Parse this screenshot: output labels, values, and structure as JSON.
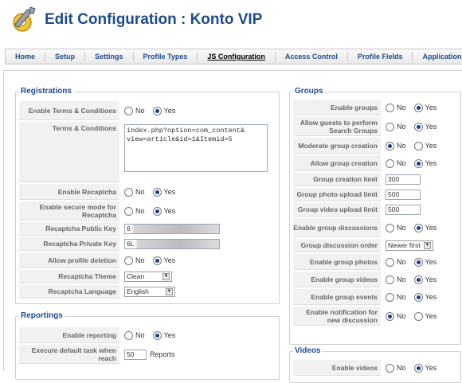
{
  "title": "Edit Configuration : Konto VIP",
  "nav": [
    "Home",
    "Setup",
    "Settings",
    "Profile Types",
    "JS Configuration",
    "Access Control",
    "Profile Fields",
    "Applications"
  ],
  "registrations": {
    "legend": "Registrations",
    "enable_terms": "Enable Terms & Conditions",
    "terms": "Terms & Conditions",
    "terms_value": "index.php?option=com_content&\nview=article&id=1&Itemid=5",
    "enable_recaptcha": "Enable Recaptcha",
    "secure_mode": "Enable secure mode for Recaptcha",
    "public_key": "Recaptcha Public Key",
    "public_key_value": "6",
    "private_key": "Recaptcha Private Key",
    "private_key_value": "6L",
    "allow_deletion": "Allow profile deletion",
    "theme": "Recaptcha Theme",
    "theme_value": "Clean",
    "language": "Recaptcha Language",
    "language_value": "English"
  },
  "reportings": {
    "legend": "Reportings",
    "enable_reporting": "Enable reporting",
    "default_task": "Execute default task when reach",
    "default_task_value": "50",
    "reports_unit": "Reports"
  },
  "groups": {
    "legend": "Groups",
    "enable_groups": "Enable groups",
    "allow_guests": "Allow guests to perform Search Groups",
    "moderate": "Moderate group creation",
    "allow_creation": "Allow group creation",
    "creation_limit": "Group creation limit",
    "creation_limit_value": "300",
    "photo_limit": "Group photo upload limit",
    "photo_limit_value": "500",
    "video_limit": "Group video upload limit",
    "video_limit_value": "500",
    "discussions": "Enable group discussions",
    "discussion_order": "Group discussion order",
    "discussion_order_value": "Newer first",
    "photos": "Enable group photos",
    "videos": "Enable group videos",
    "events": "Enable group events",
    "notification": "Enable notification for new discussion"
  },
  "videos": {
    "legend": "Videos",
    "enable_videos": "Enable videos"
  },
  "no": "No",
  "yes": "Yes"
}
